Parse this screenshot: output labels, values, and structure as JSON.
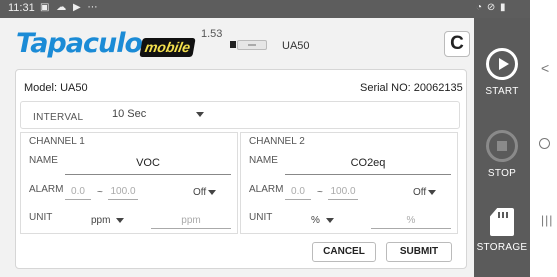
{
  "status_bar": {
    "time": "11:31",
    "left_icons": [
      "gallery-icon",
      "cloud-icon",
      "play-icon",
      "more-dots-icon"
    ],
    "left_glyphs": "▣ ☁ ▶ ⋯",
    "right_icons": [
      "wifi-icon",
      "dnd-icon",
      "battery-icon"
    ],
    "right_glyphs": "◔ ⊘ ▮"
  },
  "header": {
    "brand": "Tapaculo",
    "brand_suffix": "mobile",
    "version": "1.53",
    "device_label": "UA50",
    "refresh_glyph": "C"
  },
  "panel": {
    "model": "Model:  UA50",
    "serial": "Serial NO: 20062135",
    "interval": {
      "label": "INTERVAL",
      "value": "10 Sec"
    },
    "channels": [
      {
        "title": "CHANNEL 1",
        "name_label": "NAME",
        "name_value": "VOC",
        "alarm_label": "ALARM",
        "alarm_min": "0.0",
        "alarm_max": "100.0",
        "alarm_sep": "~",
        "alarm_state": "Off",
        "unit_label": "UNIT",
        "unit_value": "ppm",
        "unit_custom_placeholder": "ppm"
      },
      {
        "title": "CHANNEL 2",
        "name_label": "NAME",
        "name_value": "CO2eq",
        "alarm_label": "ALARM",
        "alarm_min": "0.0",
        "alarm_max": "100.0",
        "alarm_sep": "~",
        "alarm_state": "Off",
        "unit_label": "UNIT",
        "unit_value": "%",
        "unit_custom_placeholder": "%"
      }
    ],
    "cancel_label": "CANCEL",
    "submit_label": "SUBMIT"
  },
  "right_bar": {
    "start_label": "START",
    "stop_label": "STOP",
    "storage_label": "STORAGE"
  },
  "nav": {
    "back_glyph": "<",
    "recents_glyph": "|||"
  },
  "colors": {
    "brand_blue": "#1b8bd6",
    "mobile_yellow": "#f4e04d",
    "side_bar": "#5b5b5b",
    "status_bar": "#5d5d5d"
  }
}
